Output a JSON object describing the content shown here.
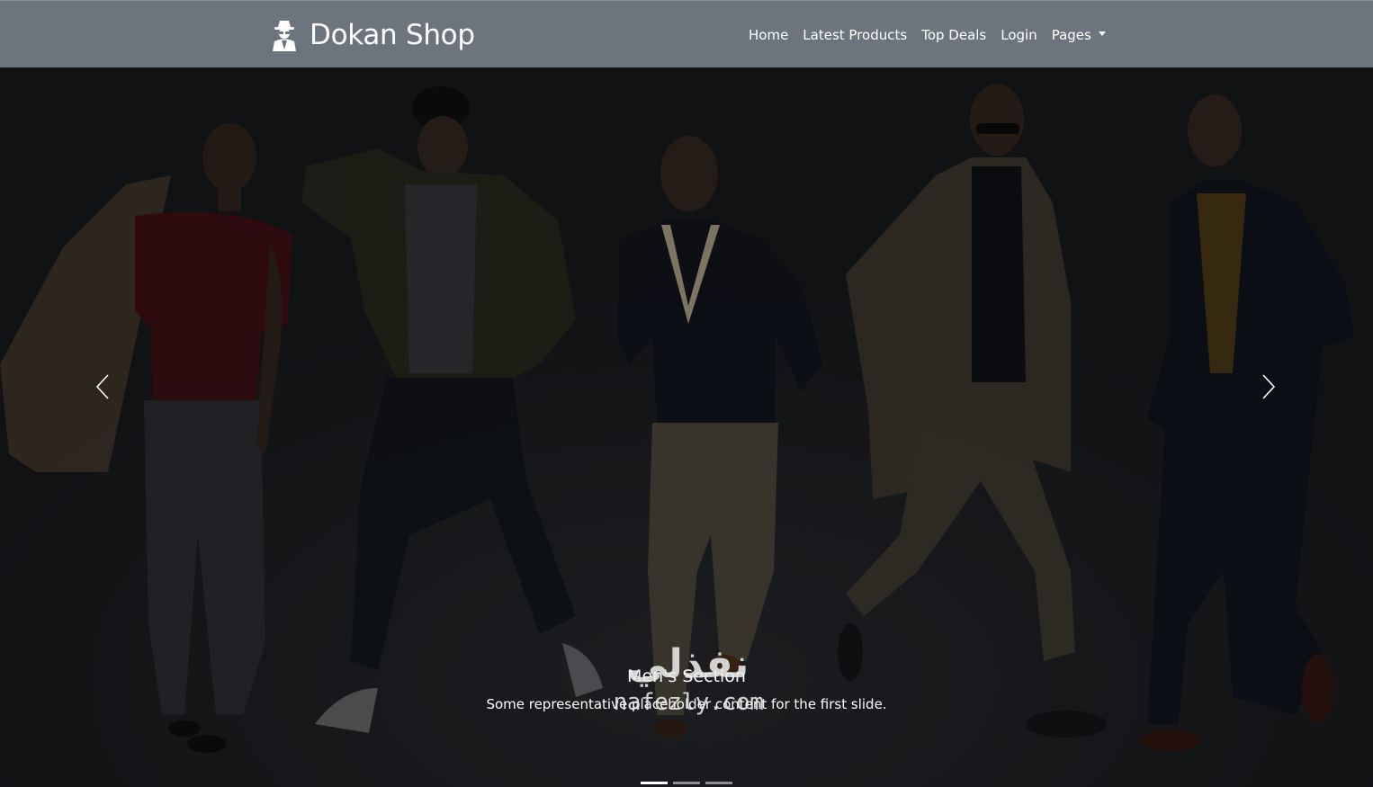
{
  "navbar": {
    "brand": "Dokan Shop",
    "brand_icon": "user-secret-icon",
    "links": [
      {
        "label": "Home"
      },
      {
        "label": "Latest Products"
      },
      {
        "label": "Top Deals"
      },
      {
        "label": "Login"
      },
      {
        "label": "Pages"
      }
    ],
    "background_color": "#6c757d"
  },
  "carousel": {
    "slide": {
      "title": "Men's Section",
      "text": "Some representative placeholder content for the first slide."
    },
    "prev_icon": "chevron-left-icon",
    "next_icon": "chevron-right-icon",
    "indicators": [
      {
        "active": true
      },
      {
        "active": false
      },
      {
        "active": false
      }
    ]
  },
  "watermark": {
    "arabic": "نفذلي",
    "latin": "nafezly.com"
  }
}
